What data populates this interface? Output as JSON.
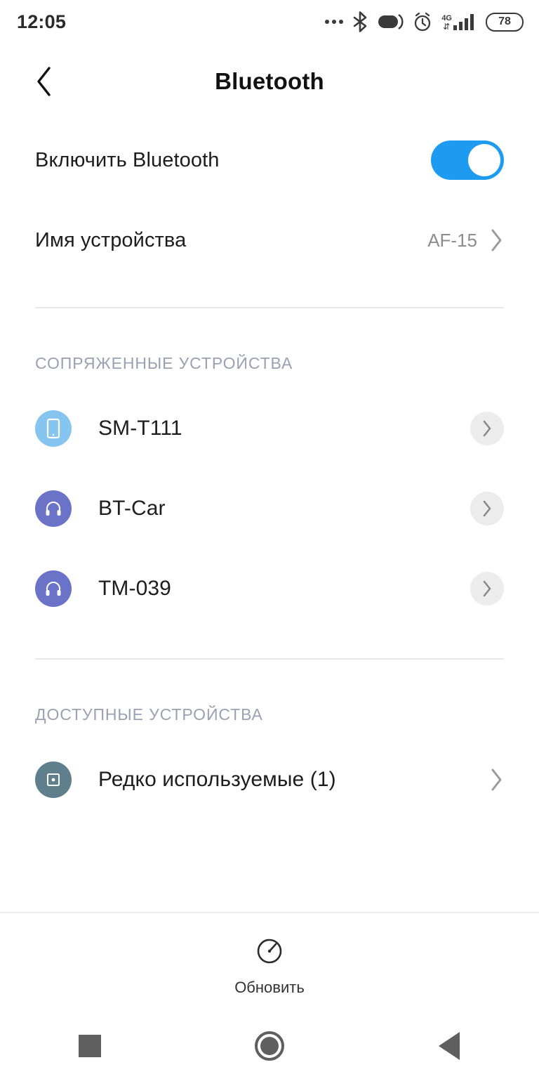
{
  "status_bar": {
    "time": "12:05",
    "battery_level": "78",
    "network_type": "4G",
    "icons": [
      "more-dots-icon",
      "bluetooth-icon",
      "data-saver-icon",
      "alarm-clock-icon",
      "signal-4g-icon",
      "battery-icon"
    ]
  },
  "header": {
    "title": "Bluetooth",
    "back_icon": "chevron-left-icon"
  },
  "settings": {
    "enable_label": "Включить Bluetooth",
    "enable_state": "on",
    "device_name_label": "Имя устройства",
    "device_name_value": "AF-15"
  },
  "paired_section": {
    "title": "СОПРЯЖЕННЫЕ УСТРОЙСТВА",
    "devices": [
      {
        "name": "SM-T111",
        "icon": "smartphone-icon",
        "icon_color": "#86c5ef"
      },
      {
        "name": "BT-Car",
        "icon": "headset-icon",
        "icon_color": "#6b73c9"
      },
      {
        "name": "TM-039",
        "icon": "headset-icon",
        "icon_color": "#6b73c9"
      }
    ]
  },
  "available_section": {
    "title": "ДОСТУПНЫЕ УСТРОЙСТВА",
    "devices": [
      {
        "name": "Редко используемые (1)",
        "icon": "device-square-icon",
        "icon_color": "#5f7f8c"
      }
    ]
  },
  "refresh_bar": {
    "label": "Обновить",
    "icon": "refresh-gauge-icon"
  },
  "nav_bar": {
    "recents": "recents-square-icon",
    "home": "home-circle-icon",
    "back": "back-triangle-icon"
  },
  "colors": {
    "accent": "#1d9bf0",
    "section_header": "#9aa1b4",
    "divider": "#e9e9e9",
    "muted_text": "#8d8d8d"
  }
}
